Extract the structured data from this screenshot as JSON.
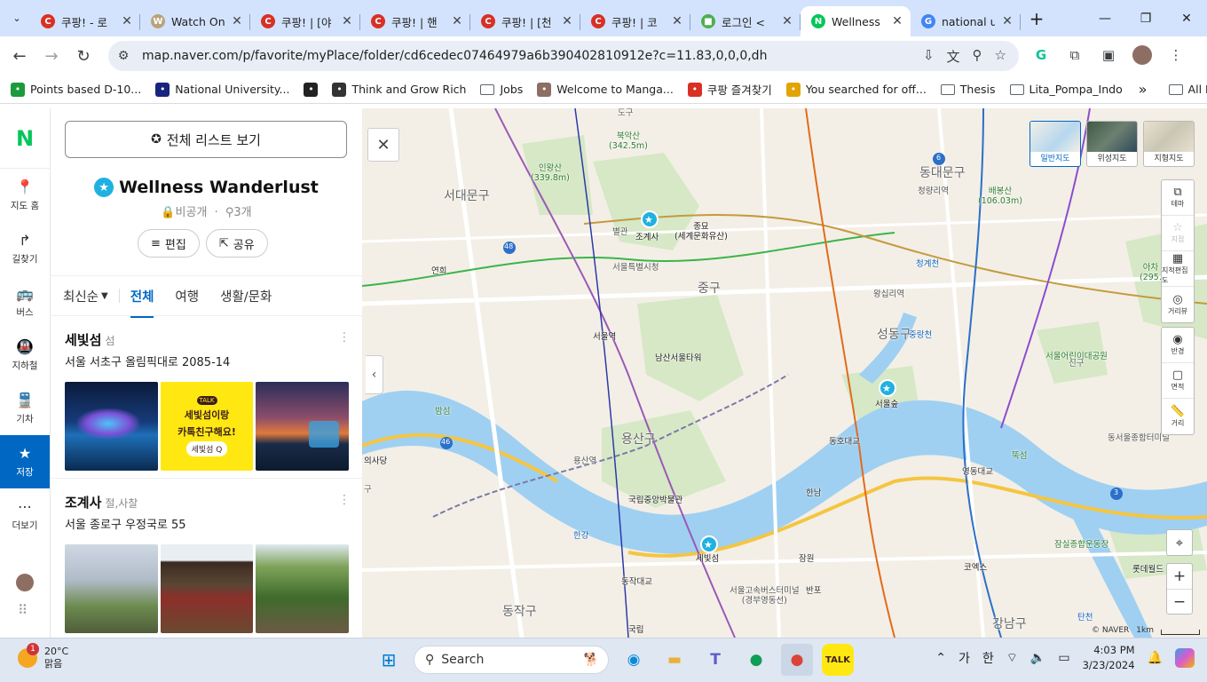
{
  "browser": {
    "tabs": [
      {
        "title": "쿠팡! - 로",
        "fav": "C",
        "color": "#d93025"
      },
      {
        "title": "Watch On",
        "fav": "W",
        "color": "#b8a37a"
      },
      {
        "title": "쿠팡! | [야",
        "fav": "C",
        "color": "#d93025"
      },
      {
        "title": "쿠팡! | 핸",
        "fav": "C",
        "color": "#d93025"
      },
      {
        "title": "쿠팡! | [천",
        "fav": "C",
        "color": "#d93025"
      },
      {
        "title": "쿠팡! | 코",
        "fav": "C",
        "color": "#d93025"
      },
      {
        "title": "로그인 <",
        "fav": "■",
        "color": "#4caf50"
      },
      {
        "title": "Wellness",
        "fav": "N",
        "color": "#03c75a",
        "active": true
      },
      {
        "title": "national u",
        "fav": "G",
        "color": "#4285f4"
      }
    ],
    "url": "map.naver.com/p/favorite/myPlace/folder/cd6cedec07464979a6b390402810912e?c=11.83,0,0,0,dh",
    "bookmarks": [
      {
        "label": "Points based D-10...",
        "icon": "doc-icon",
        "color": "#1a9b3c"
      },
      {
        "label": "National University...",
        "icon": "university-icon",
        "color": "#1a237e"
      },
      {
        "label": "",
        "icon": "mountain-icon",
        "color": "#222"
      },
      {
        "label": "Think and Grow Rich",
        "icon": "globe-icon",
        "color": "#333"
      },
      {
        "label": "Jobs",
        "icon": "folder-icon",
        "color": "#5f6368"
      },
      {
        "label": "Welcome to Manga...",
        "icon": "manga-icon",
        "color": "#8d6e63"
      },
      {
        "label": "쿠팡 즐겨찾기",
        "icon": "coupang-icon",
        "color": "#d93025"
      },
      {
        "label": "You searched for off...",
        "icon": "g-icon",
        "color": "#e2a400"
      },
      {
        "label": "Thesis",
        "icon": "folder-icon",
        "color": "#5f6368"
      },
      {
        "label": "Lita_Pompa_Indo",
        "icon": "folder-icon",
        "color": "#5f6368"
      }
    ],
    "bookmarks_more": "»",
    "all_bookmarks": "All Bookmarks"
  },
  "rail": {
    "logo": "N",
    "items": [
      {
        "label": "지도 홈",
        "icon": "📍"
      },
      {
        "label": "길찾기",
        "icon": "↱"
      },
      {
        "label": "버스",
        "icon": "🚌"
      },
      {
        "label": "지하철",
        "icon": "🚇"
      },
      {
        "label": "기차",
        "icon": "🚆"
      },
      {
        "label": "저장",
        "icon": "★",
        "active": true
      },
      {
        "label": "더보기",
        "icon": "⋯"
      }
    ]
  },
  "panel": {
    "full_list_button": "전체 리스트 보기",
    "title": "Wellness Wanderlust",
    "privacy": "비공개",
    "count": "3개",
    "edit": "편집",
    "share": "공유",
    "sort": "최신순",
    "filters": [
      "전체",
      "여행",
      "생활/문화"
    ],
    "items": [
      {
        "name": "세빛섬",
        "category": "섬",
        "address": "서울 서초구 올림픽대로 2085-14",
        "thumb_promo_line1": "세빛섬이랑",
        "thumb_promo_line2": "카톡친구해요!",
        "thumb_promo_tag": "세빛섬 Q",
        "thumb_promo_badge": "TALK"
      },
      {
        "name": "조계사",
        "category": "절,사찰",
        "address": "서울 종로구 우정국로 55"
      }
    ]
  },
  "map": {
    "types": [
      "일반지도",
      "위성지도",
      "지형지도"
    ],
    "controls": [
      {
        "label": "테마",
        "icon": "⧉"
      },
      {
        "label": "지점",
        "icon": "☆",
        "dim": true
      },
      {
        "label": "지적편집도",
        "icon": "▦"
      },
      {
        "label": "거리뷰",
        "icon": "◎"
      }
    ],
    "controls2": [
      {
        "label": "반경",
        "icon": "◉"
      },
      {
        "label": "면적",
        "icon": "▢"
      },
      {
        "label": "거리",
        "icon": "📏"
      }
    ],
    "labels": [
      {
        "t": "북악산",
        "s": "(342.5m)",
        "c": "#2e7d32"
      },
      {
        "t": "인왕산",
        "s": "(339.8m)",
        "c": "#2e7d32"
      },
      {
        "t": "서대문구",
        "c": "#666",
        "big": true
      },
      {
        "t": "동대문구",
        "c": "#666",
        "big": true
      },
      {
        "t": "배봉산",
        "s": "(106.03m)",
        "c": "#2e7d32"
      },
      {
        "t": "청량리역",
        "c": "#555"
      },
      {
        "t": "조계사",
        "c": "#222"
      },
      {
        "t": "종묘",
        "s": "(세계문화유산)",
        "c": "#222"
      },
      {
        "t": "별관",
        "c": "#555"
      },
      {
        "t": "서울특별시청",
        "c": "#555"
      },
      {
        "t": "청계천",
        "c": "#1565c0"
      },
      {
        "t": "중구",
        "c": "#666",
        "big": true
      },
      {
        "t": "왕십리역",
        "c": "#555"
      },
      {
        "t": "서울역",
        "c": "#222"
      },
      {
        "t": "남산서울타워",
        "c": "#222"
      },
      {
        "t": "성동구",
        "c": "#666",
        "big": true
      },
      {
        "t": "중랑천",
        "c": "#1565c0"
      },
      {
        "t": "서울어린이대공원",
        "c": "#2e7d32"
      },
      {
        "t": "서울숲",
        "c": "#222"
      },
      {
        "t": "밤섬",
        "c": "#2e7d32"
      },
      {
        "t": "용산구",
        "c": "#666",
        "big": true
      },
      {
        "t": "용산역",
        "c": "#555"
      },
      {
        "t": "동호대교",
        "c": "#333"
      },
      {
        "t": "영동대교",
        "c": "#333"
      },
      {
        "t": "국립중앙박물관",
        "c": "#222"
      },
      {
        "t": "한남",
        "c": "#333"
      },
      {
        "t": "뚝섬",
        "c": "#2e7d32"
      },
      {
        "t": "동서울종합터미널",
        "c": "#555"
      },
      {
        "t": "세빛섬",
        "c": "#222"
      },
      {
        "t": "한강",
        "c": "#1565c0"
      },
      {
        "t": "잠원",
        "c": "#333"
      },
      {
        "t": "잠실종합운동장",
        "c": "#2e7d32"
      },
      {
        "t": "코엑스",
        "c": "#222"
      },
      {
        "t": "롯데월드",
        "c": "#222"
      },
      {
        "t": "동작대교",
        "c": "#333"
      },
      {
        "t": "서울고속버스터미널",
        "s": "(경부영동선)",
        "c": "#555"
      },
      {
        "t": "반포",
        "c": "#333"
      },
      {
        "t": "동작구",
        "c": "#666",
        "big": true
      },
      {
        "t": "강남구",
        "c": "#666",
        "big": true
      },
      {
        "t": "국립",
        "c": "#222"
      },
      {
        "t": "탄천",
        "c": "#1565c0"
      },
      {
        "t": "연희",
        "c": "#333"
      },
      {
        "t": "의사당",
        "c": "#222"
      },
      {
        "t": "신구",
        "c": "#666"
      },
      {
        "t": "아차",
        "s": "(295.",
        "c": "#2e7d32"
      },
      {
        "t": "도구",
        "c": "#666"
      },
      {
        "t": "구",
        "c": "#666"
      }
    ],
    "route_numbers": [
      "6",
      "48",
      "46",
      "3"
    ],
    "copyright": "© NAVER",
    "scale": "1km"
  },
  "taskbar": {
    "temp": "20°C",
    "weather": "맑음",
    "badge": "1",
    "search": "Search",
    "ime1": "가",
    "ime2": "한",
    "time": "4:03 PM",
    "date": "3/23/2024"
  }
}
